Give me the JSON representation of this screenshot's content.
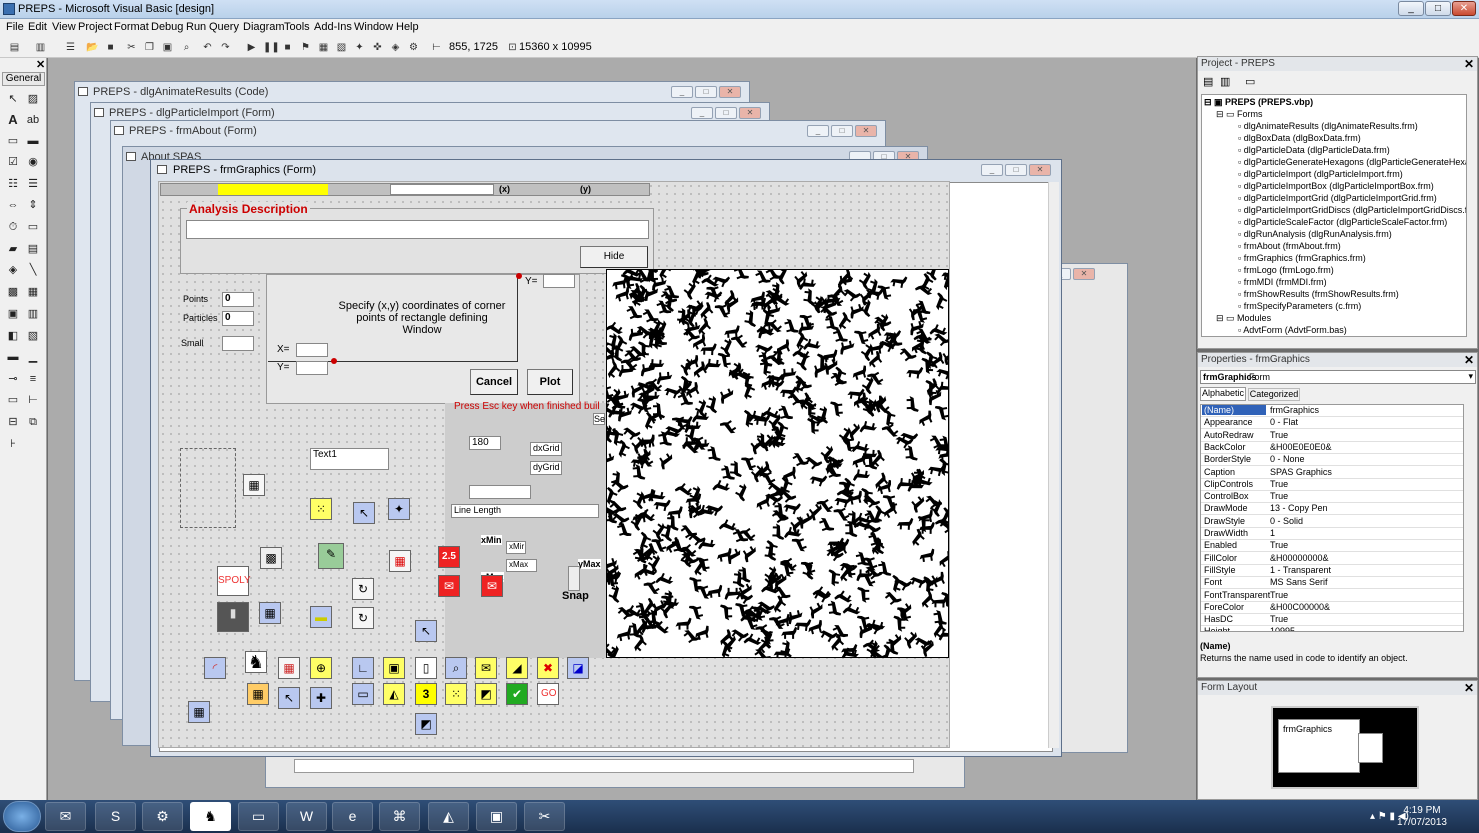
{
  "app": {
    "title": "PREPS - Microsoft Visual Basic [design]"
  },
  "menu": [
    "File",
    "Edit",
    "View",
    "Project",
    "Format",
    "Debug",
    "Run",
    "Query",
    "Diagram",
    "Tools",
    "Add-Ins",
    "Window",
    "Help"
  ],
  "toolbar": {
    "position": "855, 1725",
    "size": "15360 x 10995"
  },
  "toolbox": {
    "title": "General"
  },
  "windows": {
    "animate": "PREPS - dlgAnimateResults (Code)",
    "import": "PREPS - dlgParticleImport (Form)",
    "about": "PREPS - frmAbout (Form)",
    "spas": "About SPAS",
    "graphics": "PREPS - frmGraphics (Form)"
  },
  "form": {
    "coord_x_label": "(x)",
    "coord_y_label": "(y)",
    "analysis_title": "Analysis Description",
    "hide": "Hide",
    "points_label": "Points",
    "points_value": "0",
    "particles_label": "Particles",
    "particles_value": "0",
    "small_label": "Small",
    "instructions": "Specify (x,y) coordinates of corner points of rectangle defining Window",
    "x_label": "X=",
    "y_label": "Y=",
    "y_label2": "Y=",
    "cancel": "Cancel",
    "plot": "Plot",
    "esc_text": "Press Esc key when finished buil",
    "se_text": "Se",
    "angle_value": "180",
    "dxgrid": "dxGrid",
    "dygrid": "dyGrid",
    "text1": "Text1",
    "line_length": "Line Length",
    "xmin": "xMin",
    "xmin2": "xMir",
    "xmax": "xMax",
    "xmax2": "xMax",
    "ymax": "yMax",
    "snap": "Snap",
    "spoly": "SPOLY",
    "num_25": "2.5",
    "num_3": "3",
    "go": "GO"
  },
  "project": {
    "title": "Project - PREPS",
    "root": "PREPS (PREPS.vbp)",
    "forms_folder": "Forms",
    "items": [
      "dlgAnimateResults (dlgAnimateResults.frm)",
      "dlgBoxData (dlgBoxData.frm)",
      "dlgParticleData (dlgParticleData.frm)",
      "dlgParticleGenerateHexagons (dlgParticleGenerateHexa",
      "dlgParticleImport (dlgParticleImport.frm)",
      "dlgParticleImportBox (dlgParticleImportBox.frm)",
      "dlgParticleImportGrid (dlgParticleImportGrid.frm)",
      "dlgParticleImportGridDiscs (dlgParticleImportGridDiscs.fr",
      "dlgParticleScaleFactor (dlgParticleScaleFactor.frm)",
      "dlgRunAnalysis (dlgRunAnalysis.frm)",
      "frmAbout (frmAbout.frm)",
      "frmGraphics (frmGraphics.frm)",
      "frmLogo (frmLogo.frm)",
      "frmMDI (frmMDI.frm)",
      "frmShowResults (frmShowResults.frm)",
      "frmSpecifyParameters (c.frm)"
    ],
    "modules_folder": "Modules",
    "module_item": "AdvtForm (AdvtForm.bas)"
  },
  "properties": {
    "title": "Properties - frmGraphics",
    "object": "frmGraphics",
    "object_type": "Form",
    "tab_alpha": "Alphabetic",
    "tab_cat": "Categorized",
    "rows": [
      [
        "(Name)",
        "frmGraphics"
      ],
      [
        "Appearance",
        "0 - Flat"
      ],
      [
        "AutoRedraw",
        "True"
      ],
      [
        "BackColor",
        "&H00E0E0E0&"
      ],
      [
        "BorderStyle",
        "0 - None"
      ],
      [
        "Caption",
        "SPAS Graphics"
      ],
      [
        "ClipControls",
        "True"
      ],
      [
        "ControlBox",
        "True"
      ],
      [
        "DrawMode",
        "13 - Copy Pen"
      ],
      [
        "DrawStyle",
        "0 - Solid"
      ],
      [
        "DrawWidth",
        "1"
      ],
      [
        "Enabled",
        "True"
      ],
      [
        "FillColor",
        "&H00000000&"
      ],
      [
        "FillStyle",
        "1 - Transparent"
      ],
      [
        "Font",
        "MS Sans Serif"
      ],
      [
        "FontTransparent",
        "True"
      ],
      [
        "ForeColor",
        "&H00C00000&"
      ],
      [
        "HasDC",
        "True"
      ],
      [
        "Height",
        "10995"
      ]
    ],
    "desc_title": "(Name)",
    "desc_text": "Returns the name used in code to identify an object."
  },
  "layout_window": {
    "title": "Form Layout",
    "form_label": "frmGraphics"
  },
  "clock": {
    "time": "4:19 PM",
    "date": "17/07/2013"
  },
  "colors": {
    "yellow": "#ffff00",
    "red_text": "#cc0000",
    "selection": "#3062b8"
  }
}
